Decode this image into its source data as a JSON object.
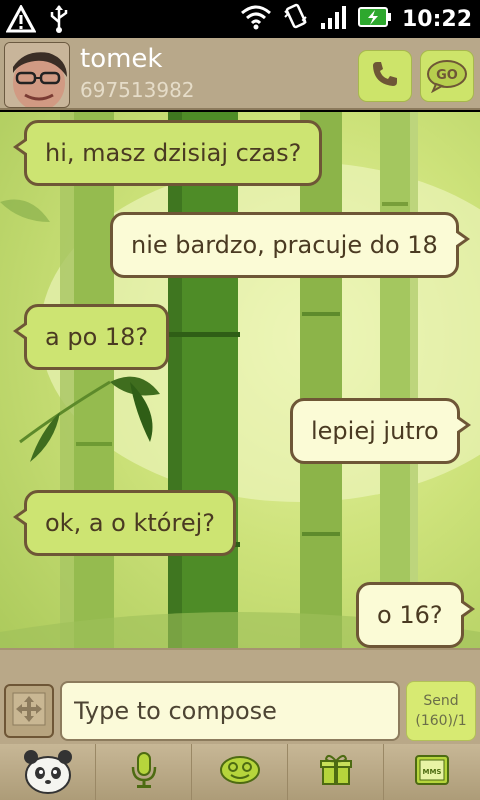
{
  "status_bar": {
    "time": "10:22",
    "icons": [
      "warning-icon",
      "usb-icon",
      "wifi-icon",
      "vibrate-icon",
      "signal-icon",
      "battery-charging-icon"
    ]
  },
  "header": {
    "contact_name": "tomek",
    "contact_number": "697513982",
    "call_icon": "phone-icon",
    "go_label": "GO"
  },
  "messages": [
    {
      "direction": "in",
      "text": "hi, masz dzisiaj czas?"
    },
    {
      "direction": "out",
      "text": "nie bardzo, pracuje do 18"
    },
    {
      "direction": "in",
      "text": "a po 18?"
    },
    {
      "direction": "out",
      "text": "lepiej jutro"
    },
    {
      "direction": "in",
      "text": "ok, a o której?"
    },
    {
      "direction": "out",
      "text": "o 16?"
    }
  ],
  "compose": {
    "placeholder": "Type to compose",
    "send_label": "Send",
    "counter": "(160)/1"
  },
  "toolbar": {
    "items": [
      "panda-icon",
      "microphone-icon",
      "emoticon-icon",
      "gift-icon",
      "mms-icon"
    ],
    "mms_label": "MMS"
  },
  "colors": {
    "incoming_bubble": "#cde472",
    "outgoing_bubble": "#fbfbd6",
    "accent": "#cde46a",
    "header_bg": "#b8a88a"
  }
}
